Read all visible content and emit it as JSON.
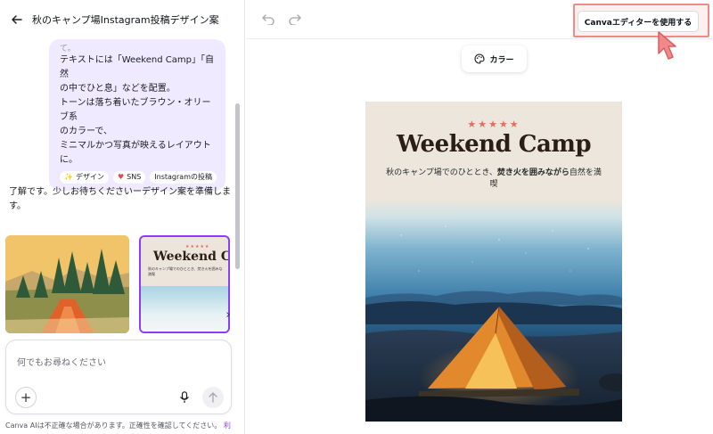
{
  "left_panel": {
    "title": "秋のキャンプ場Instagram投稿デザイン案",
    "prompt_bubble": {
      "faded_text": "て。",
      "text": "テキストには「Weekend Camp」「自然\nの中でひと息」などを配置。\nトーンは落ち着いたブラウン・オリーブ系\nのカラーで、\nミニマルかつ写真が映えるレイアウト\nに。",
      "chips": [
        {
          "icon": "sparkle-icon",
          "label": "デザイン"
        },
        {
          "icon": "heart-icon",
          "label": "SNS"
        },
        {
          "icon": "",
          "label": "Instagramの投稿"
        }
      ]
    },
    "reply": "了解です。少しお待ちくださいーデザイン案を準備しま\nす。",
    "thumbnail2": {
      "stars": "★★★★★",
      "title": "Weekend Ca",
      "subtitle": "秋のキャンプ場でのひととき、焚き火を囲みな\n満喫"
    },
    "input": {
      "placeholder": "何でもお尋ねください"
    },
    "disclaimer": "Canva AIは不正確な場合があります。正確性を確認してください。",
    "disclaimer_link": "利"
  },
  "right_panel": {
    "canva_button": "Canvaエディターを使用する",
    "color_button": "カラー",
    "poster": {
      "stars": "★★★★★",
      "title": "Weekend Camp",
      "subtitle_pre": "秋のキャンプ場でのひととき、",
      "subtitle_bold": "焚き火を囲みながら",
      "subtitle_post": "自然を満喫"
    }
  },
  "colors": {
    "accent": "#8b3dff",
    "highlight_border": "#f08a8a",
    "bubble_bg": "#efeaff",
    "poster_bg": "#ece5dc",
    "poster_title": "#2b1e16",
    "stars": "#e86b5d"
  }
}
